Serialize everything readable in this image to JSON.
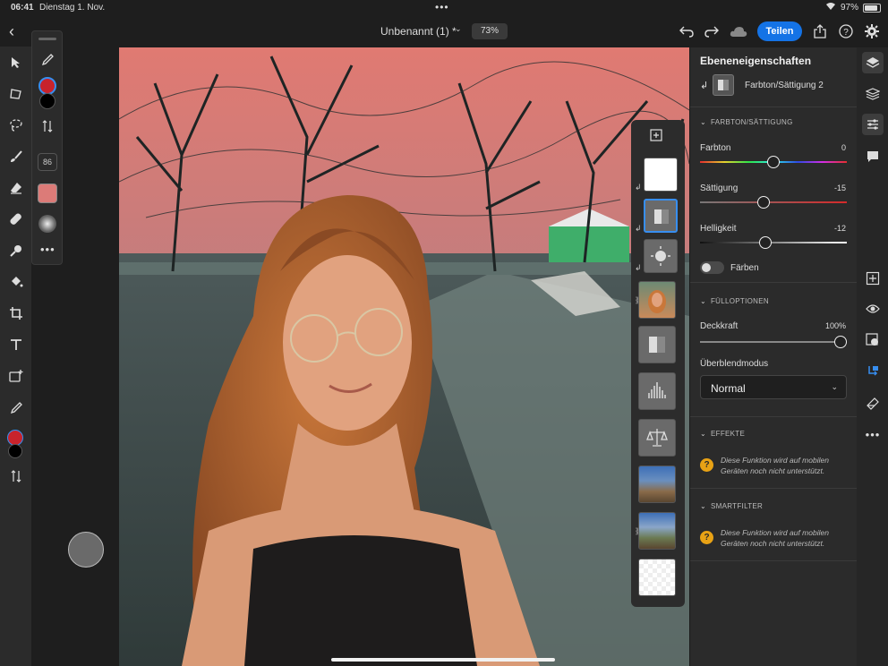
{
  "status": {
    "time": "06:41",
    "date": "Dienstag 1. Nov.",
    "battery": "97%"
  },
  "topbar": {
    "title": "Unbenannt (1) *",
    "zoom": "73%",
    "share_label": "Teilen"
  },
  "toolopts": {
    "size": "86",
    "colors": {
      "foreground": "#c8232c",
      "background": "#000000",
      "swatch": "#dc7b78"
    }
  },
  "layers": {
    "items": [
      {
        "kind": "add",
        "icon": "plus-icon"
      },
      {
        "kind": "white-fill",
        "clipped": true
      },
      {
        "kind": "hue-saturation",
        "clipped": true,
        "selected": true
      },
      {
        "kind": "brightness",
        "clipped": true
      },
      {
        "kind": "portrait-photo",
        "linked": true
      },
      {
        "kind": "hue-saturation"
      },
      {
        "kind": "levels"
      },
      {
        "kind": "color-balance"
      },
      {
        "kind": "park-photo"
      },
      {
        "kind": "park-photo",
        "linked": true
      },
      {
        "kind": "transparent"
      }
    ]
  },
  "props": {
    "title": "Ebeneneigenschaften",
    "layer_name": "Farbton/Sättigung 2",
    "sections": {
      "hue": "FARBTON/SÄTTIGUNG",
      "fill": "FÜLLOPTIONEN",
      "effects": "EFFEKTE",
      "smart": "SMARTFILTER"
    },
    "hue_label": "Farbton",
    "hue_value": "0",
    "sat_label": "Sättigung",
    "sat_value": "-15",
    "light_label": "Helligkeit",
    "light_value": "-12",
    "colorize_label": "Färben",
    "opacity_label": "Deckkraft",
    "opacity_value": "100%",
    "blend_label": "Überblendmodus",
    "blend_value": "Normal",
    "effects_note": "Diese Funktion wird auf mobilen Geräten noch nicht unterstützt.",
    "smart_note": "Diese Funktion wird auf mobilen Geräten noch nicht unterstützt."
  }
}
